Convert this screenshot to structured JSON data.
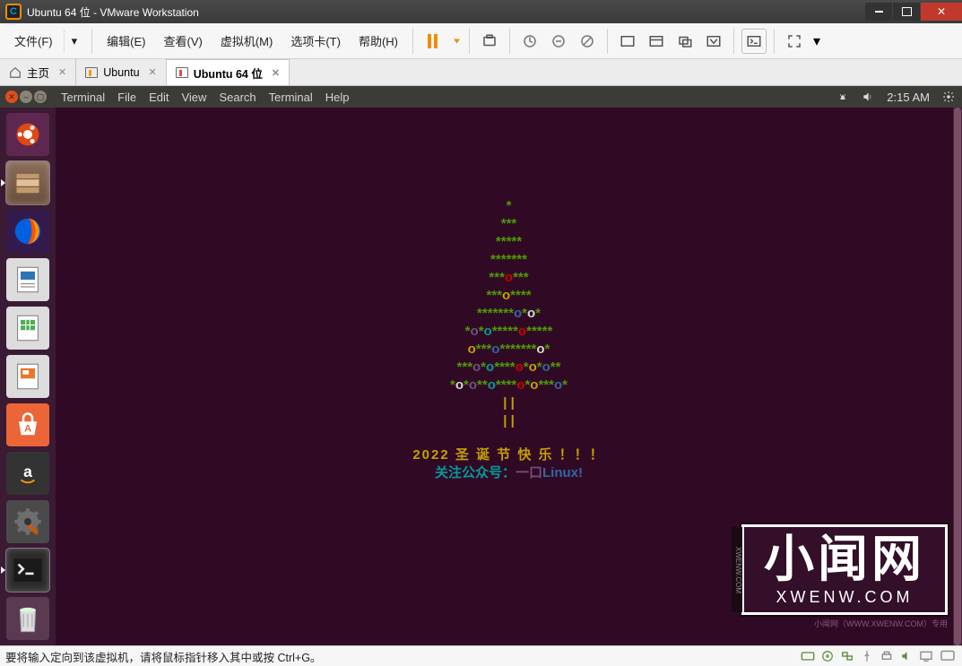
{
  "vmware": {
    "title": "Ubuntu 64 位 - VMware Workstation",
    "menu": {
      "file": "文件(F)",
      "edit": "编辑(E)",
      "view": "查看(V)",
      "vm": "虚拟机(M)",
      "tabs": "选项卡(T)",
      "help": "帮助(H)"
    },
    "tabs": {
      "home": "主页",
      "ubuntu": "Ubuntu",
      "ubuntu64": "Ubuntu 64 位"
    },
    "status": "要将输入定向到该虚拟机，请将鼠标指针移入其中或按 Ctrl+G。"
  },
  "ubuntu": {
    "menu": {
      "terminal1": "Terminal",
      "file": "File",
      "edit": "Edit",
      "view": "View",
      "search": "Search",
      "terminal2": "Terminal",
      "help": "Help"
    },
    "clock": "2:15 AM"
  },
  "terminal": {
    "tree": [
      "*",
      "***",
      "*****",
      "*******",
      "***o***",
      "***o****",
      "*******o*o*",
      "*o*o*****o*****",
      "o***o*******o*",
      "***o*o****o*o*o**",
      "*o*o**o****o*o***o*"
    ],
    "trunk": "| |",
    "greet1": "2022 圣 诞 节 快 乐 ！！！",
    "greet2_a": "关注公众号：",
    "greet2_b": "一口",
    "greet2_c": "Linux!"
  },
  "watermark": {
    "big": "小闻网",
    "small": "XWENW.COM",
    "side": "XWENW.COM",
    "foot": "小闻网（WWW.XWENW.COM）专用"
  }
}
